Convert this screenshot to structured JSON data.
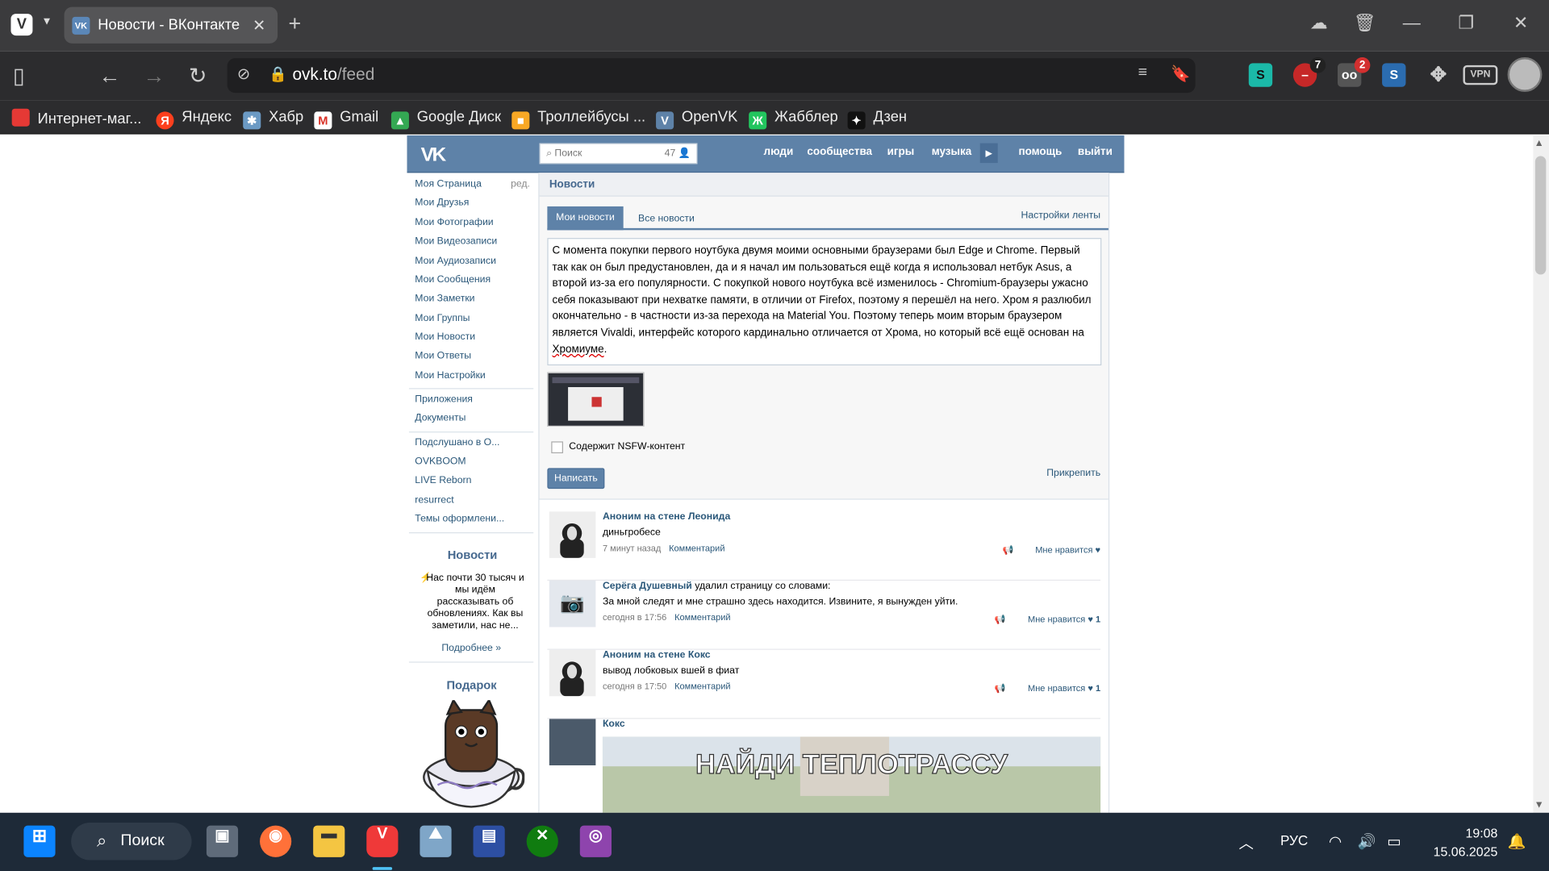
{
  "browser": {
    "tab_title": "Новости - ВКонтакте",
    "url_domain": "ovk.to",
    "url_path": "/feed",
    "ext_badges": [
      "7",
      "2"
    ],
    "vpn_label": "VPN",
    "bookmarks": [
      "Интернет-маг...",
      "Яндекс",
      "Хабр",
      "Gmail",
      "Google Диск",
      "Троллейбусы ...",
      "OpenVK",
      "Жабблер",
      "Дзен"
    ]
  },
  "vk": {
    "search_placeholder": "Поиск",
    "search_count": "47",
    "nav": [
      "люди",
      "сообщества",
      "игры",
      "музыка",
      "помощь",
      "выйти"
    ],
    "menu": [
      "Моя Страница",
      "Мои Друзья",
      "Мои Фотографии",
      "Мои Видеозаписи",
      "Мои Аудиозаписи",
      "Мои Сообщения",
      "Мои Заметки",
      "Мои Группы",
      "Мои Новости",
      "Мои Ответы",
      "Мои Настройки"
    ],
    "menu_edit": "ред.",
    "menu2": [
      "Приложения",
      "Документы"
    ],
    "menu3": [
      "Подслушано в О...",
      "OVKBOOM",
      "LIVE Reborn",
      "resurrect",
      "Темы оформлени..."
    ],
    "side_news_title": "Новости",
    "side_news_text": "Нас почти 30 тысяч и мы идём рассказывать об обновлениях. Как вы заметили, нас не...",
    "side_news_more": "Подробнее »",
    "gift_title": "Подарок",
    "page_title": "Новости",
    "tab_mine": "Мои новости",
    "tab_all": "Все новости",
    "feed_settings": "Настройки ленты",
    "composer_text": "С момента покупки первого ноутбука двумя моими основными браузерами был Edge и Chrome. Первый так как он был предустановлен, да и я начал им пользоваться ещё когда я использовал нетбук Asus, а второй из-за его популярности. С покупкой нового ноутбука всё изменилось - Chromium-браузеры ужасно себя показывают при нехватке памяти, в отличии от Firefox, поэтому я перешёл на него. Хром я разлюбил окончательно - в частности из-за перехода на Material You. Поэтому теперь моим вторым браузером является Vivaldi, интерфейс которого кардинально отличается от Хрома, но который всё ещё основан на",
    "composer_last_word": "Хромиуме",
    "nsfw_label": "Содержит NSFW-контент",
    "post_button": "Написать",
    "attach_label": "Прикрепить",
    "posts": [
      {
        "author": "Аноним на стене Леонида",
        "extra": "",
        "text": "диньгробесе",
        "time": "7 минут назад",
        "comment": "Комментарий",
        "like": "Мне нравится",
        "count": ""
      },
      {
        "author": "Серёга Душевный",
        "extra": " удалил страницу со словами:",
        "text": "За мной следят и мне страшно здесь находится. Извините, я вынужден уйти.",
        "time": "сегодня в 17:56",
        "comment": "Комментарий",
        "like": "Мне нравится",
        "count": "1"
      },
      {
        "author": "Аноним на стене Кокс",
        "extra": "",
        "text": "вывод лобковых вшей в фиат",
        "time": "сегодня в 17:50",
        "comment": "Комментарий",
        "like": "Мне нравится",
        "count": "1"
      },
      {
        "author": "Кокс",
        "extra": "",
        "text": "",
        "time": "",
        "comment": "",
        "like": "",
        "count": ""
      }
    ],
    "meme_caption": "НАЙДИ ТЕПЛОТРАССУ"
  },
  "taskbar": {
    "search_label": "Поиск",
    "lang": "РУС",
    "time": "19:08",
    "date": "15.06.2025"
  }
}
